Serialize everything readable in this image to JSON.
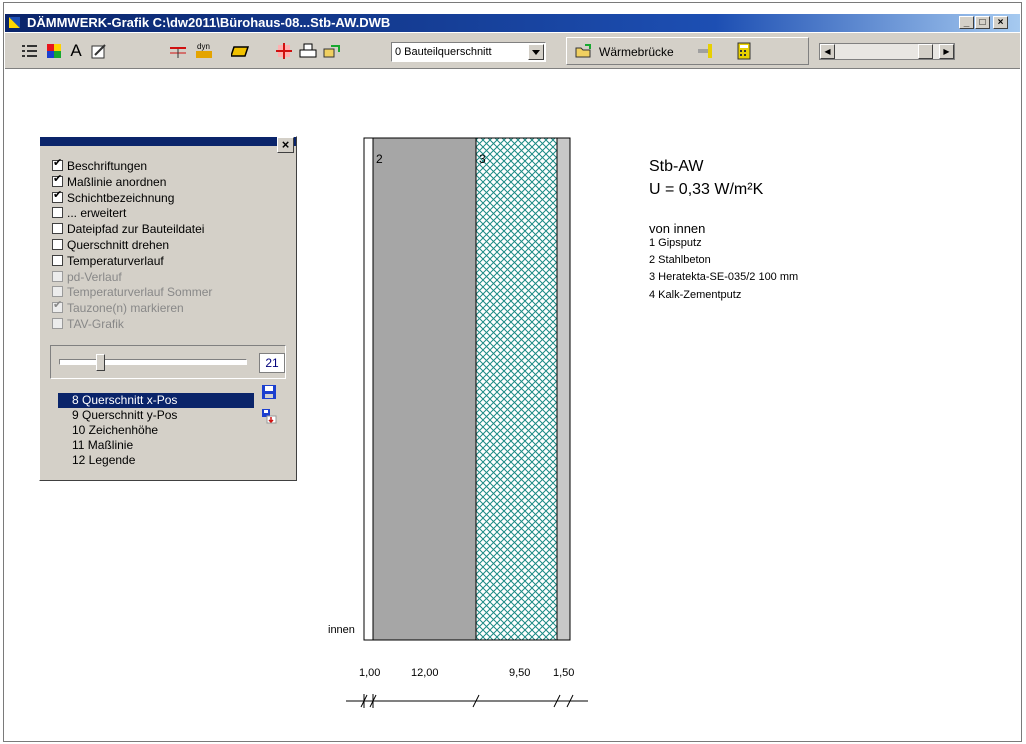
{
  "window": {
    "title": "DÄMMWERK-Grafik  C:\\dw2011\\Bürohaus-08...Stb-AW.DWB"
  },
  "toolbar": {
    "combo_value": "0 Bauteilquerschnitt",
    "waermebruecke_label": "Wärmebrücke",
    "icons": [
      "list-settings-icon",
      "color-palette-icon",
      "font-icon",
      "edit-note-icon",
      "dimension-icon",
      "dyn-icon",
      "material-icon",
      "grid-icon",
      "print-icon",
      "export-icon"
    ]
  },
  "options_panel": {
    "checkboxes": [
      {
        "label": "Beschriftungen",
        "checked": true,
        "enabled": true
      },
      {
        "label": "Maßlinie anordnen",
        "checked": true,
        "enabled": true
      },
      {
        "label": "Schichtbezeichnung",
        "checked": true,
        "enabled": true
      },
      {
        "label": "... erweitert",
        "checked": false,
        "enabled": true
      },
      {
        "label": "Dateipfad zur Bauteildatei",
        "checked": false,
        "enabled": true
      },
      {
        "label": "Querschnitt drehen",
        "checked": false,
        "enabled": true
      },
      {
        "label": "Temperaturverlauf",
        "checked": false,
        "enabled": true
      },
      {
        "label": "pd-Verlauf",
        "checked": false,
        "enabled": false
      },
      {
        "label": "Temperaturverlauf Sommer",
        "checked": false,
        "enabled": false
      },
      {
        "label": "Tauzone(n) markieren",
        "checked": true,
        "enabled": false
      },
      {
        "label": "TAV-Grafik",
        "checked": false,
        "enabled": false
      }
    ],
    "slider_value": "21",
    "list": [
      {
        "label": "8 Querschnitt x-Pos",
        "selected": true
      },
      {
        "label": "9 Querschnitt y-Pos",
        "selected": false
      },
      {
        "label": "10 Zeichenhöhe",
        "selected": false
      },
      {
        "label": "11 Maßlinie",
        "selected": false
      },
      {
        "label": "12 Legende",
        "selected": false
      }
    ]
  },
  "drawing": {
    "name": "Stb-AW",
    "u_value": "U = 0,33 W/m²K",
    "legend_heading": "von innen",
    "legend": [
      "1 Gipsputz",
      "2 Stahlbeton",
      "3 Heratekta-SE-035/2  100 mm",
      "4 Kalk-Zementputz"
    ],
    "layer_labels": [
      "2",
      "3"
    ],
    "side_label": "innen",
    "dimensions": [
      "1,00",
      "12,00",
      "9,50",
      "1,50"
    ],
    "colors": {
      "concrete": "#a6a6a6",
      "insulation_bg": "#ffffff",
      "insulation_hatch": "#1b8a84",
      "plaster": "#c8c8c8"
    }
  }
}
